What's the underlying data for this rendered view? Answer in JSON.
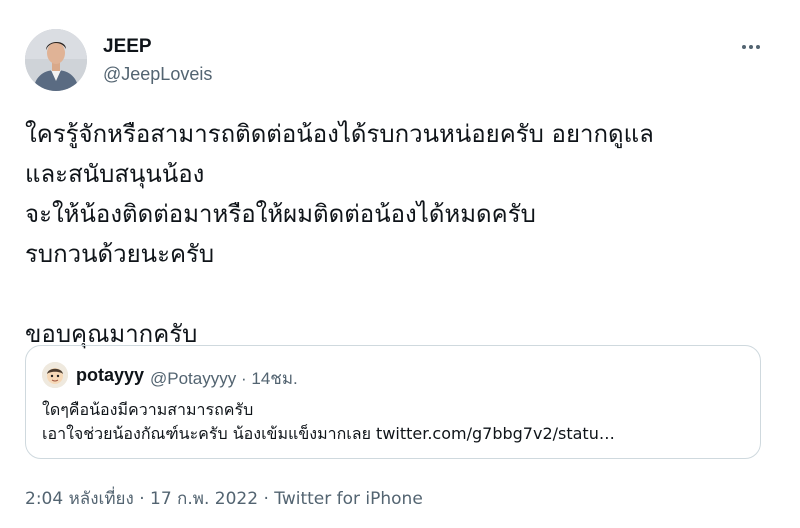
{
  "author": {
    "display_name": "JEEP",
    "handle": "@JeepLoveis"
  },
  "menu": {
    "icon": "more-horizontal-icon"
  },
  "tweet_text": {
    "line1": "ใครรู้จักหรือสามารถติดต่อน้องได้รบกวนหน่อยครับ อยากดูแล",
    "line2": "และสนับสนุนน้อง",
    "line3": "จะให้น้องติดต่อมาหรือให้ผมติดต่อน้องได้หมดครับ",
    "line4": "รบกวนด้วยนะครับ",
    "line5": "ขอบคุณมากครับ"
  },
  "quoted_tweet": {
    "display_name": "potayyy",
    "handle": "@Potayyyy",
    "separator": "·",
    "time": "14ชม.",
    "text_line1": "ใดๆคือน้องมีความสามารถครับ",
    "text_line2": "เอาใจช่วยน้องกัณฑ์นะครับ น้องเข้มแข็งมากเลย twitter.com/g7bbg7v2/statu…"
  },
  "footer": {
    "time": "2:04 หลังเที่ยง",
    "sep1": "·",
    "date": "17 ก.พ. 2022",
    "sep2": "·",
    "source": "Twitter for iPhone"
  }
}
